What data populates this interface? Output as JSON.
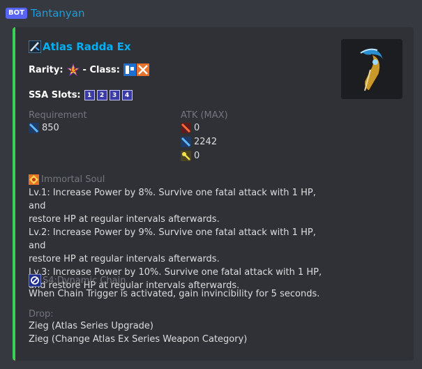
{
  "message": {
    "bot_badge": "BOT",
    "username": "Tantanyan"
  },
  "embed": {
    "accent_color": "#3ad158",
    "title": "Atlas Radda Ex",
    "title_icon": "gunslash-weapon-icon",
    "rarity_label": "Rarity:",
    "rarity_icon": "rarity-15-star-icon",
    "class_separator": "- Class:",
    "class_icons": [
      "ranger-class-icon",
      "gunner-class-icon"
    ],
    "ssa_label": "SSA Slots:",
    "ssa_slots": [
      "1",
      "2",
      "3",
      "4"
    ],
    "requirement": {
      "label": "Requirement",
      "value": "850",
      "icon": "ranged-power-icon"
    },
    "atk": {
      "label": "ATK (MAX)",
      "values": [
        {
          "icon": "melee-attack-icon",
          "value": "0"
        },
        {
          "icon": "ranged-attack-icon",
          "value": "2242"
        },
        {
          "icon": "technique-attack-icon",
          "value": "0"
        }
      ]
    },
    "potential": {
      "icon": "potential-icon",
      "name": "Immortal Soul",
      "lines": [
        "Lv.1: Increase Power by 8%. Survive one fatal attack with 1 HP, and",
        "restore HP at regular intervals afterwards.",
        "Lv.2: Increase Power by 9%. Survive one fatal attack with 1 HP, and",
        "restore HP at regular intervals afterwards.",
        "Lv.3: Increase Power by 10%. Survive one fatal attack with 1 HP,",
        "and restore HP at regular intervals afterwards."
      ]
    },
    "ssa": {
      "icon": "s4-ability-icon",
      "name": "S4:Dynamic Chain",
      "description": "When Chain Trigger is activated, gain invincibility for 5 seconds."
    },
    "drop": {
      "label": "Drop:",
      "items": [
        "Zieg (Atlas Series Upgrade)",
        "Zieg (Change Atlas Ex Series Weapon Category)"
      ]
    }
  }
}
